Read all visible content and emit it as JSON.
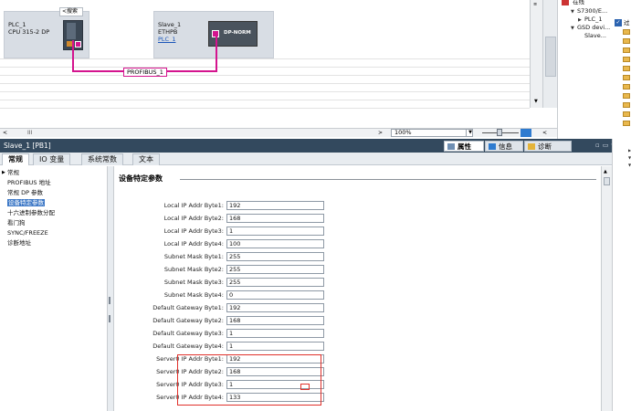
{
  "network": {
    "plc": {
      "name": "PLC_1",
      "model": "CPU 315-2 DP"
    },
    "slave": {
      "name": "Slave_1",
      "type": "ETHPB",
      "link": "PLC_1",
      "module_label": "DP-NORM"
    },
    "bus_label": "PROFIBUS_1",
    "zoom": "100%",
    "scroll_glyph": "III"
  },
  "tree": {
    "header": "在线",
    "filter_value": "<搜索",
    "items": [
      "S7300/E...",
      "PLC_1",
      "GSD devi...",
      "Slave..."
    ],
    "checkbox_label": "过"
  },
  "inspector": {
    "title": "Slave_1 [PB1]",
    "tabs": {
      "properties": "属性",
      "info": "信息",
      "diagnostics": "诊断"
    },
    "subtabs": [
      "常规",
      "IO 变量",
      "系统常数",
      "文本"
    ]
  },
  "nav": {
    "items": [
      "常规",
      "PROFIBUS 地址",
      "常规 DP 参数",
      "设备特定参数",
      "十六进制参数分配",
      "看门狗",
      "SYNC/FREEZE",
      "诊断地址"
    ]
  },
  "section_title": "设备特定参数",
  "params": [
    {
      "label": "Local IP Addr Byte1:",
      "value": "192"
    },
    {
      "label": "Local IP Addr Byte2:",
      "value": "168"
    },
    {
      "label": "Local IP Addr Byte3:",
      "value": "1"
    },
    {
      "label": "Local IP Addr Byte4:",
      "value": "100"
    },
    {
      "label": "Subnet Mask Byte1:",
      "value": "255"
    },
    {
      "label": "Subnet Mask Byte2:",
      "value": "255"
    },
    {
      "label": "Subnet Mask Byte3:",
      "value": "255"
    },
    {
      "label": "Subnet Mask Byte4:",
      "value": "0"
    },
    {
      "label": "Default Gateway Byte1:",
      "value": "192"
    },
    {
      "label": "Default Gateway Byte2:",
      "value": "168"
    },
    {
      "label": "Default Gateway Byte3:",
      "value": "1"
    },
    {
      "label": "Default Gateway Byte4:",
      "value": "1"
    },
    {
      "label": "Server0 IP Addr Byte1:",
      "value": "192"
    },
    {
      "label": "Server0 IP Addr Byte2:",
      "value": "168"
    },
    {
      "label": "Server0 IP Addr Byte3:",
      "value": "1"
    },
    {
      "label": "Server0 IP Addr Byte4:",
      "value": "133"
    }
  ],
  "colors": {
    "accent_bus": "#d4148e",
    "header_bg": "#33495e",
    "highlight": "#e0312b",
    "selection": "#3d78c6"
  }
}
